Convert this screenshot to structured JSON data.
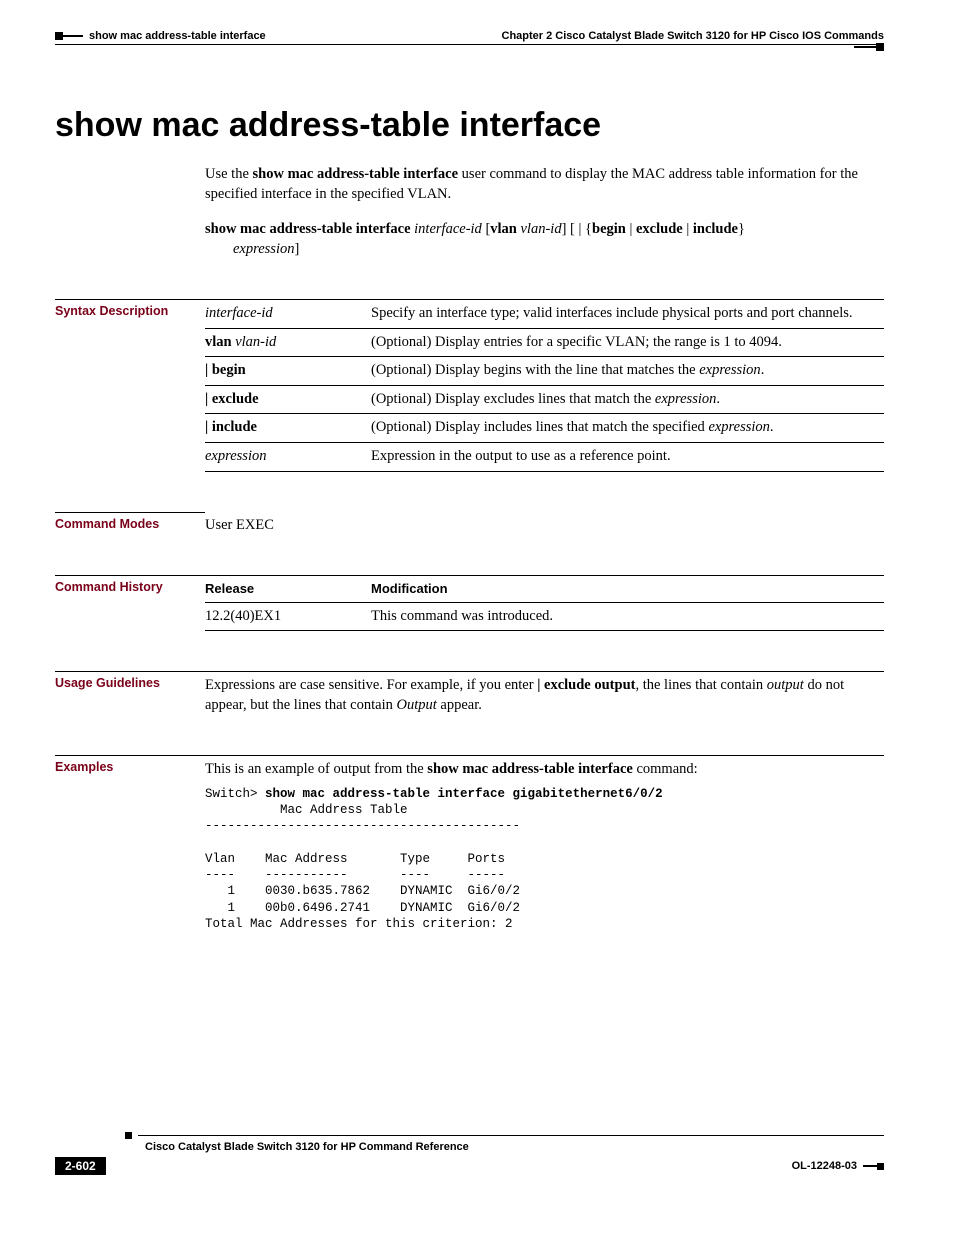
{
  "header": {
    "breadcrumb": "show mac address-table interface",
    "chapter": "Chapter 2  Cisco Catalyst Blade Switch 3120 for HP Cisco IOS Commands"
  },
  "title": "show mac address-table interface",
  "intro": {
    "prefix": "Use the ",
    "bold": "show mac address-table interface",
    "suffix": " user command to display the MAC address table information for the specified interface in the specified VLAN."
  },
  "syntax": {
    "cmd_bold1": "show mac address-table interface",
    "arg_italic1": "interface-id",
    "open_br": "[",
    "vlan_bold": "vlan",
    "vlan_arg_italic": "vlan-id",
    "close_br1": "]",
    "pipe_open": "[ | {",
    "begin": "begin",
    "sep1": "|",
    "exclude": "exclude",
    "sep2": "|",
    "include": "include",
    "close_br2": "}",
    "line2_italic": "expression",
    "line2_suffix": "]"
  },
  "labels": {
    "syntax_desc": "Syntax Description",
    "command_modes": "Command Modes",
    "command_history": "Command History",
    "usage": "Usage Guidelines",
    "examples": "Examples"
  },
  "syntax_table": [
    {
      "param_italic": "interface-id",
      "param_bold": "",
      "desc_pre": "Specify an interface type; valid interfaces include physical ports and port channels.",
      "desc_italic": "",
      "desc_post": ""
    },
    {
      "param_bold": "vlan",
      "param_italic": "vlan-id",
      "desc_pre": "(Optional) Display entries for a specific VLAN; the range is 1 to 4094.",
      "desc_italic": "",
      "desc_post": ""
    },
    {
      "param_bold": "| begin",
      "param_italic": "",
      "desc_pre": "(Optional) Display begins with the line that matches the ",
      "desc_italic": "expression",
      "desc_post": "."
    },
    {
      "param_bold": "| exclude",
      "param_italic": "",
      "desc_pre": "(Optional) Display excludes lines that match the ",
      "desc_italic": "expression",
      "desc_post": "."
    },
    {
      "param_bold": "| include",
      "param_italic": "",
      "desc_pre": "(Optional) Display includes lines that match the specified ",
      "desc_italic": "expression",
      "desc_post": "."
    },
    {
      "param_italic": "expression",
      "param_bold": "",
      "desc_pre": "Expression in the output to use as a reference point.",
      "desc_italic": "",
      "desc_post": ""
    }
  ],
  "command_modes_value": "User EXEC",
  "history_table": {
    "h1": "Release",
    "h2": "Modification",
    "r1c1": "12.2(40)EX1",
    "r1c2": "This command was introduced."
  },
  "usage": {
    "t1": "Expressions are case sensitive. For example, if you enter ",
    "b1": "| exclude output",
    "t2": ", the lines that contain ",
    "i1": "output",
    "t3": " do not appear, but the lines that contain ",
    "i2": "Output",
    "t4": " appear."
  },
  "examples": {
    "intro_pre": "This is an example of output from the ",
    "intro_bold": "show mac address-table interface",
    "intro_post": " command:",
    "prompt": "Switch> ",
    "cmd": "show mac address-table interface gigabitethernet6/0/2",
    "output": "          Mac Address Table\n------------------------------------------\n\nVlan    Mac Address       Type     Ports\n----    -----------       ----     -----\n   1    0030.b635.7862    DYNAMIC  Gi6/0/2\n   1    00b0.6496.2741    DYNAMIC  Gi6/0/2\nTotal Mac Addresses for this criterion: 2"
  },
  "footer": {
    "doc_title": "Cisco Catalyst Blade Switch 3120 for HP Command Reference",
    "page": "2-602",
    "doc_id": "OL-12248-03"
  }
}
